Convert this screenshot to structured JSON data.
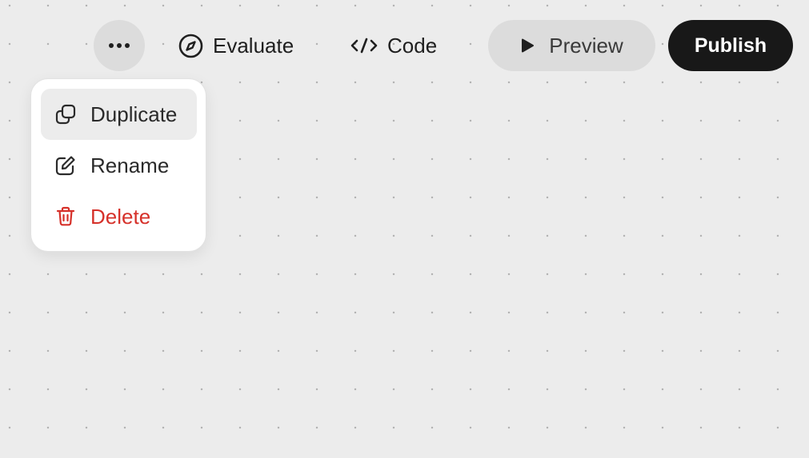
{
  "toolbar": {
    "more_icon": "more-horizontal-icon",
    "evaluate_label": "Evaluate",
    "evaluate_icon": "compass-icon",
    "code_label": "Code",
    "code_icon": "code-icon",
    "preview_label": "Preview",
    "preview_icon": "play-icon",
    "publish_label": "Publish"
  },
  "menu": {
    "items": [
      {
        "label": "Duplicate",
        "icon": "duplicate-icon",
        "highlighted": true
      },
      {
        "label": "Rename",
        "icon": "edit-icon",
        "highlighted": false
      },
      {
        "label": "Delete",
        "icon": "trash-icon",
        "highlighted": false,
        "color": "#d6312a"
      }
    ]
  },
  "colors": {
    "canvas_background": "#ececec",
    "publish_background": "#181818",
    "danger": "#d6312a"
  }
}
